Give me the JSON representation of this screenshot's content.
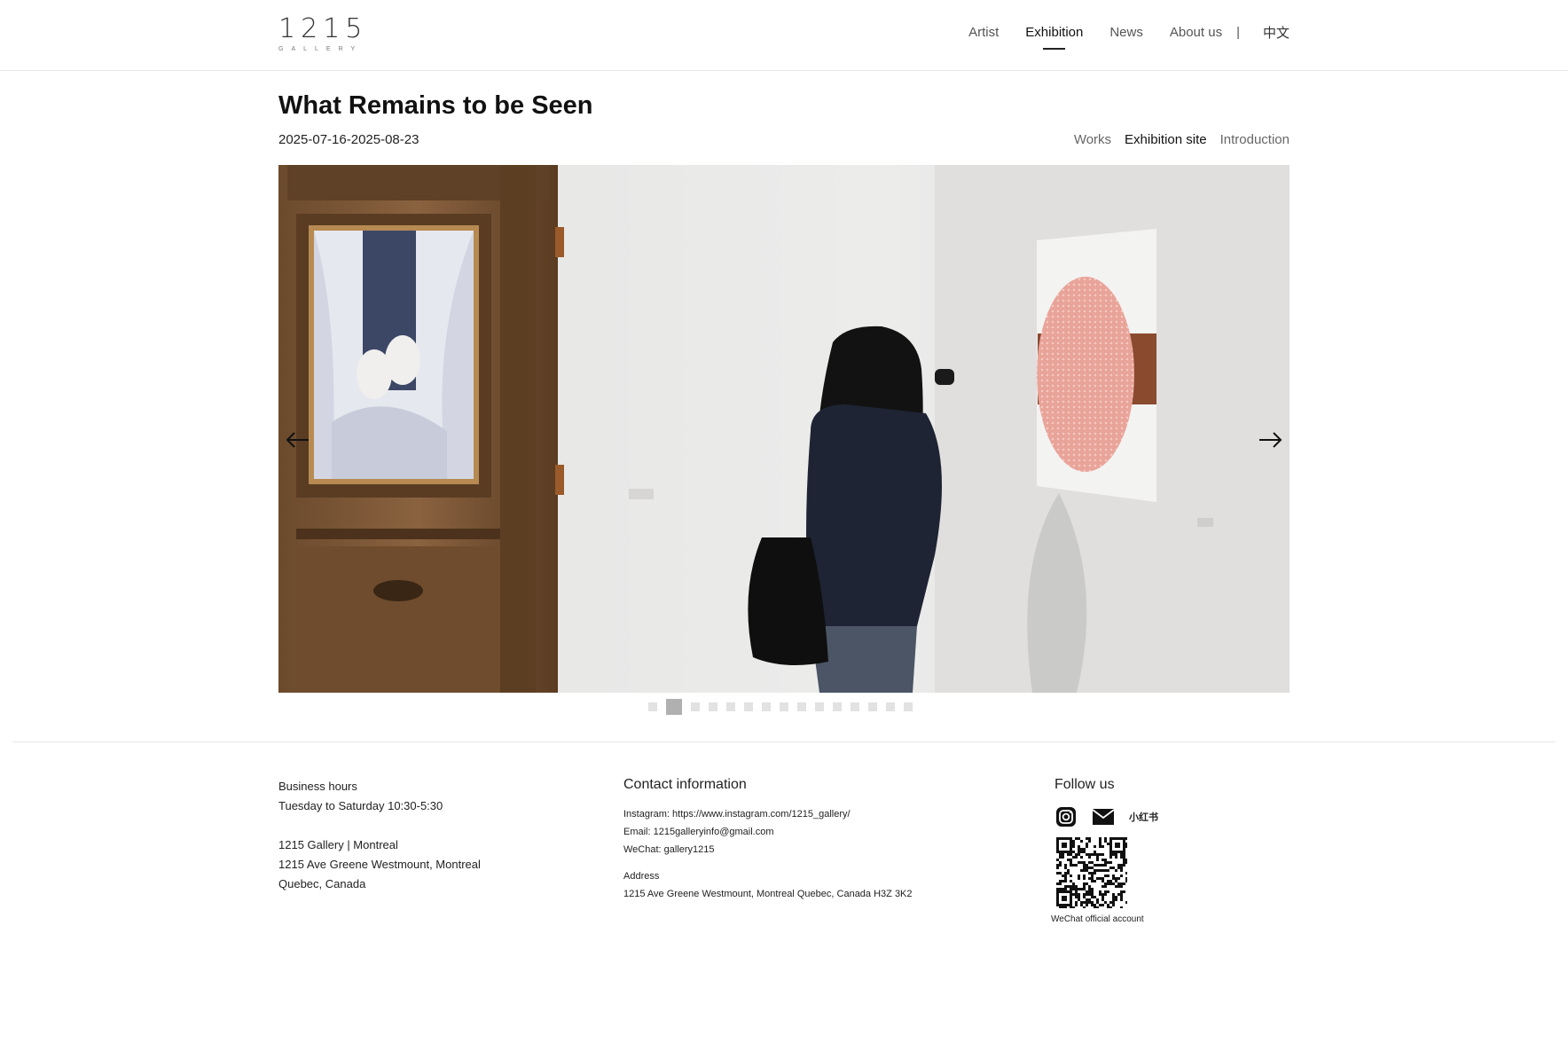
{
  "header": {
    "logo_number": "1215",
    "logo_sub": "GALLERY",
    "nav": [
      {
        "label": "Artist"
      },
      {
        "label": "Exhibition"
      },
      {
        "label": "News"
      },
      {
        "label": "About us"
      }
    ],
    "separator": "|",
    "language": "中文"
  },
  "exhibition": {
    "title": "What Remains to be Seen",
    "dates": "2025-07-16-2025-08-23",
    "subnav": [
      {
        "label": "Works"
      },
      {
        "label": "Exhibition site"
      },
      {
        "label": "Introduction"
      }
    ]
  },
  "carousel": {
    "slide_count": 15,
    "active_index": 1,
    "prev_icon": "arrow-left-icon",
    "next_icon": "arrow-right-icon"
  },
  "footer": {
    "business": {
      "hours_label": "Business hours",
      "hours": "Tuesday to Saturday 10:30-5:30",
      "name": "1215 Gallery | Montreal",
      "address_line1": "1215 Ave Greene Westmount, Montreal",
      "address_line2": "Quebec, Canada"
    },
    "contact": {
      "heading": "Contact information",
      "instagram": "Instagram: https://www.instagram.com/1215_gallery/",
      "email": "Email: 1215galleryinfo@gmail.com",
      "wechat": "WeChat: gallery1215",
      "address_label": "Address",
      "address": "1215 Ave Greene Westmount, Montreal Quebec, Canada H3Z 3K2"
    },
    "follow": {
      "heading": "Follow us",
      "xiaohongshu": "小红书",
      "qr_caption": "WeChat official account"
    }
  },
  "colors": {
    "text": "#1a1a1a",
    "divider": "#e6e6e6",
    "dot_active": "#b0b0b0",
    "dot_inactive": "#e2e2e2"
  }
}
